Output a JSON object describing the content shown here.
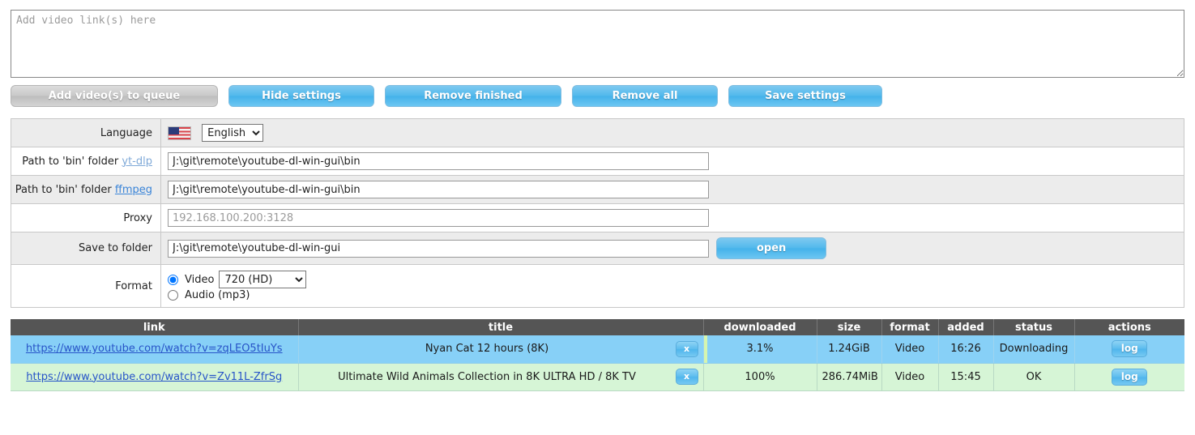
{
  "input": {
    "placeholder": "Add video link(s) here",
    "value": ""
  },
  "toolbar": {
    "add_label": "Add video(s) to queue",
    "hide_settings_label": "Hide settings",
    "remove_finished_label": "Remove finished",
    "remove_all_label": "Remove all",
    "save_settings_label": "Save settings"
  },
  "settings": {
    "language": {
      "label": "Language",
      "flag": "us-flag-icon",
      "selected": "English",
      "options": [
        "English"
      ]
    },
    "ytdlp_path": {
      "label_prefix": "Path to 'bin' folder",
      "label_link": "yt-dlp",
      "value": "J:\\git\\remote\\youtube-dl-win-gui\\bin"
    },
    "ffmpeg_path": {
      "label_prefix": "Path to 'bin' folder",
      "label_link": "ffmpeg",
      "value": "J:\\git\\remote\\youtube-dl-win-gui\\bin"
    },
    "proxy": {
      "label": "Proxy",
      "value": "",
      "placeholder": "192.168.100.200:3128"
    },
    "save_folder": {
      "label": "Save to folder",
      "value": "J:\\git\\remote\\youtube-dl-win-gui",
      "open_label": "open"
    },
    "format": {
      "label": "Format",
      "video_label": "Video",
      "video_selected": "720 (HD)",
      "video_options": [
        "720 (HD)"
      ],
      "audio_label": "Audio (mp3)",
      "selected_mode": "video"
    }
  },
  "queue": {
    "headers": {
      "link": "link",
      "title": "title",
      "downloaded": "downloaded",
      "size": "size",
      "format": "format",
      "added": "added",
      "status": "status",
      "actions": "actions"
    },
    "rows": [
      {
        "link": "https://www.youtube.com/watch?v=zqLEO5tIuYs",
        "title": "Nyan Cat 12 hours (8K)",
        "remove_label": "x",
        "downloaded": "3.1%",
        "progress_pct": 3.1,
        "size": "1.24GiB",
        "format": "Video",
        "added": "16:26",
        "status": "Downloading",
        "action_label": "log",
        "state": "downloading"
      },
      {
        "link": "https://www.youtube.com/watch?v=Zv11L-ZfrSg",
        "title": "Ultimate Wild Animals Collection in 8K ULTRA HD / 8K TV",
        "remove_label": "x",
        "downloaded": "100%",
        "progress_pct": 100,
        "size": "286.74MiB",
        "format": "Video",
        "added": "15:45",
        "status": "OK",
        "action_label": "log",
        "state": "ok"
      }
    ]
  },
  "colors": {
    "accent": "#52b9ec",
    "header_bg": "#555555",
    "row_downloading": "#87d0f7",
    "row_ok": "#d6f5d6",
    "link": "#2754c8"
  }
}
